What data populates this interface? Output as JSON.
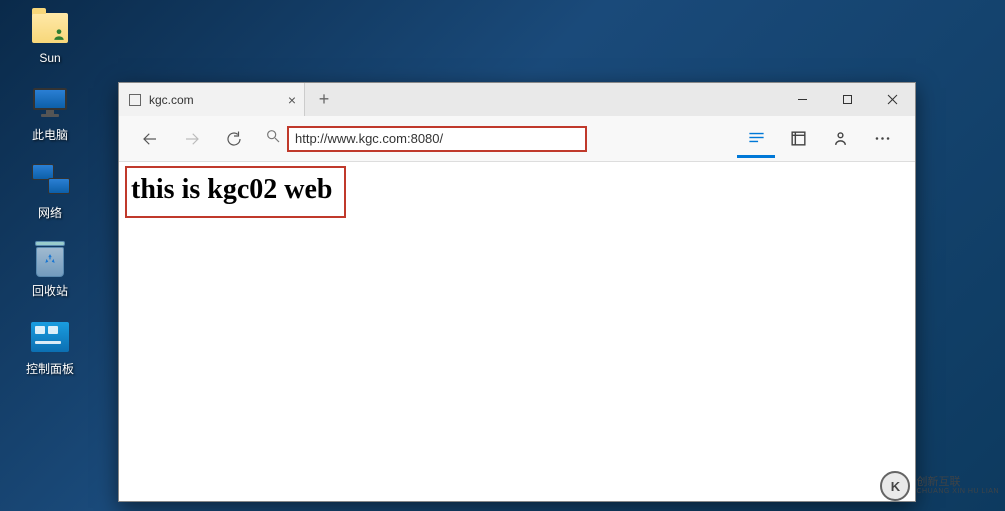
{
  "desktop": {
    "items": [
      {
        "label": "Sun"
      },
      {
        "label": "此电脑"
      },
      {
        "label": "网络"
      },
      {
        "label": "回收站"
      },
      {
        "label": "控制面板"
      }
    ]
  },
  "browser": {
    "tab": {
      "title": "kgc.com"
    },
    "url": "http://www.kgc.com:8080/",
    "page_text": "this is kgc02 web"
  },
  "watermark": {
    "logo_letter": "K",
    "line1": "创新互联",
    "line2": "CHUANG XIN HU LIAN"
  }
}
